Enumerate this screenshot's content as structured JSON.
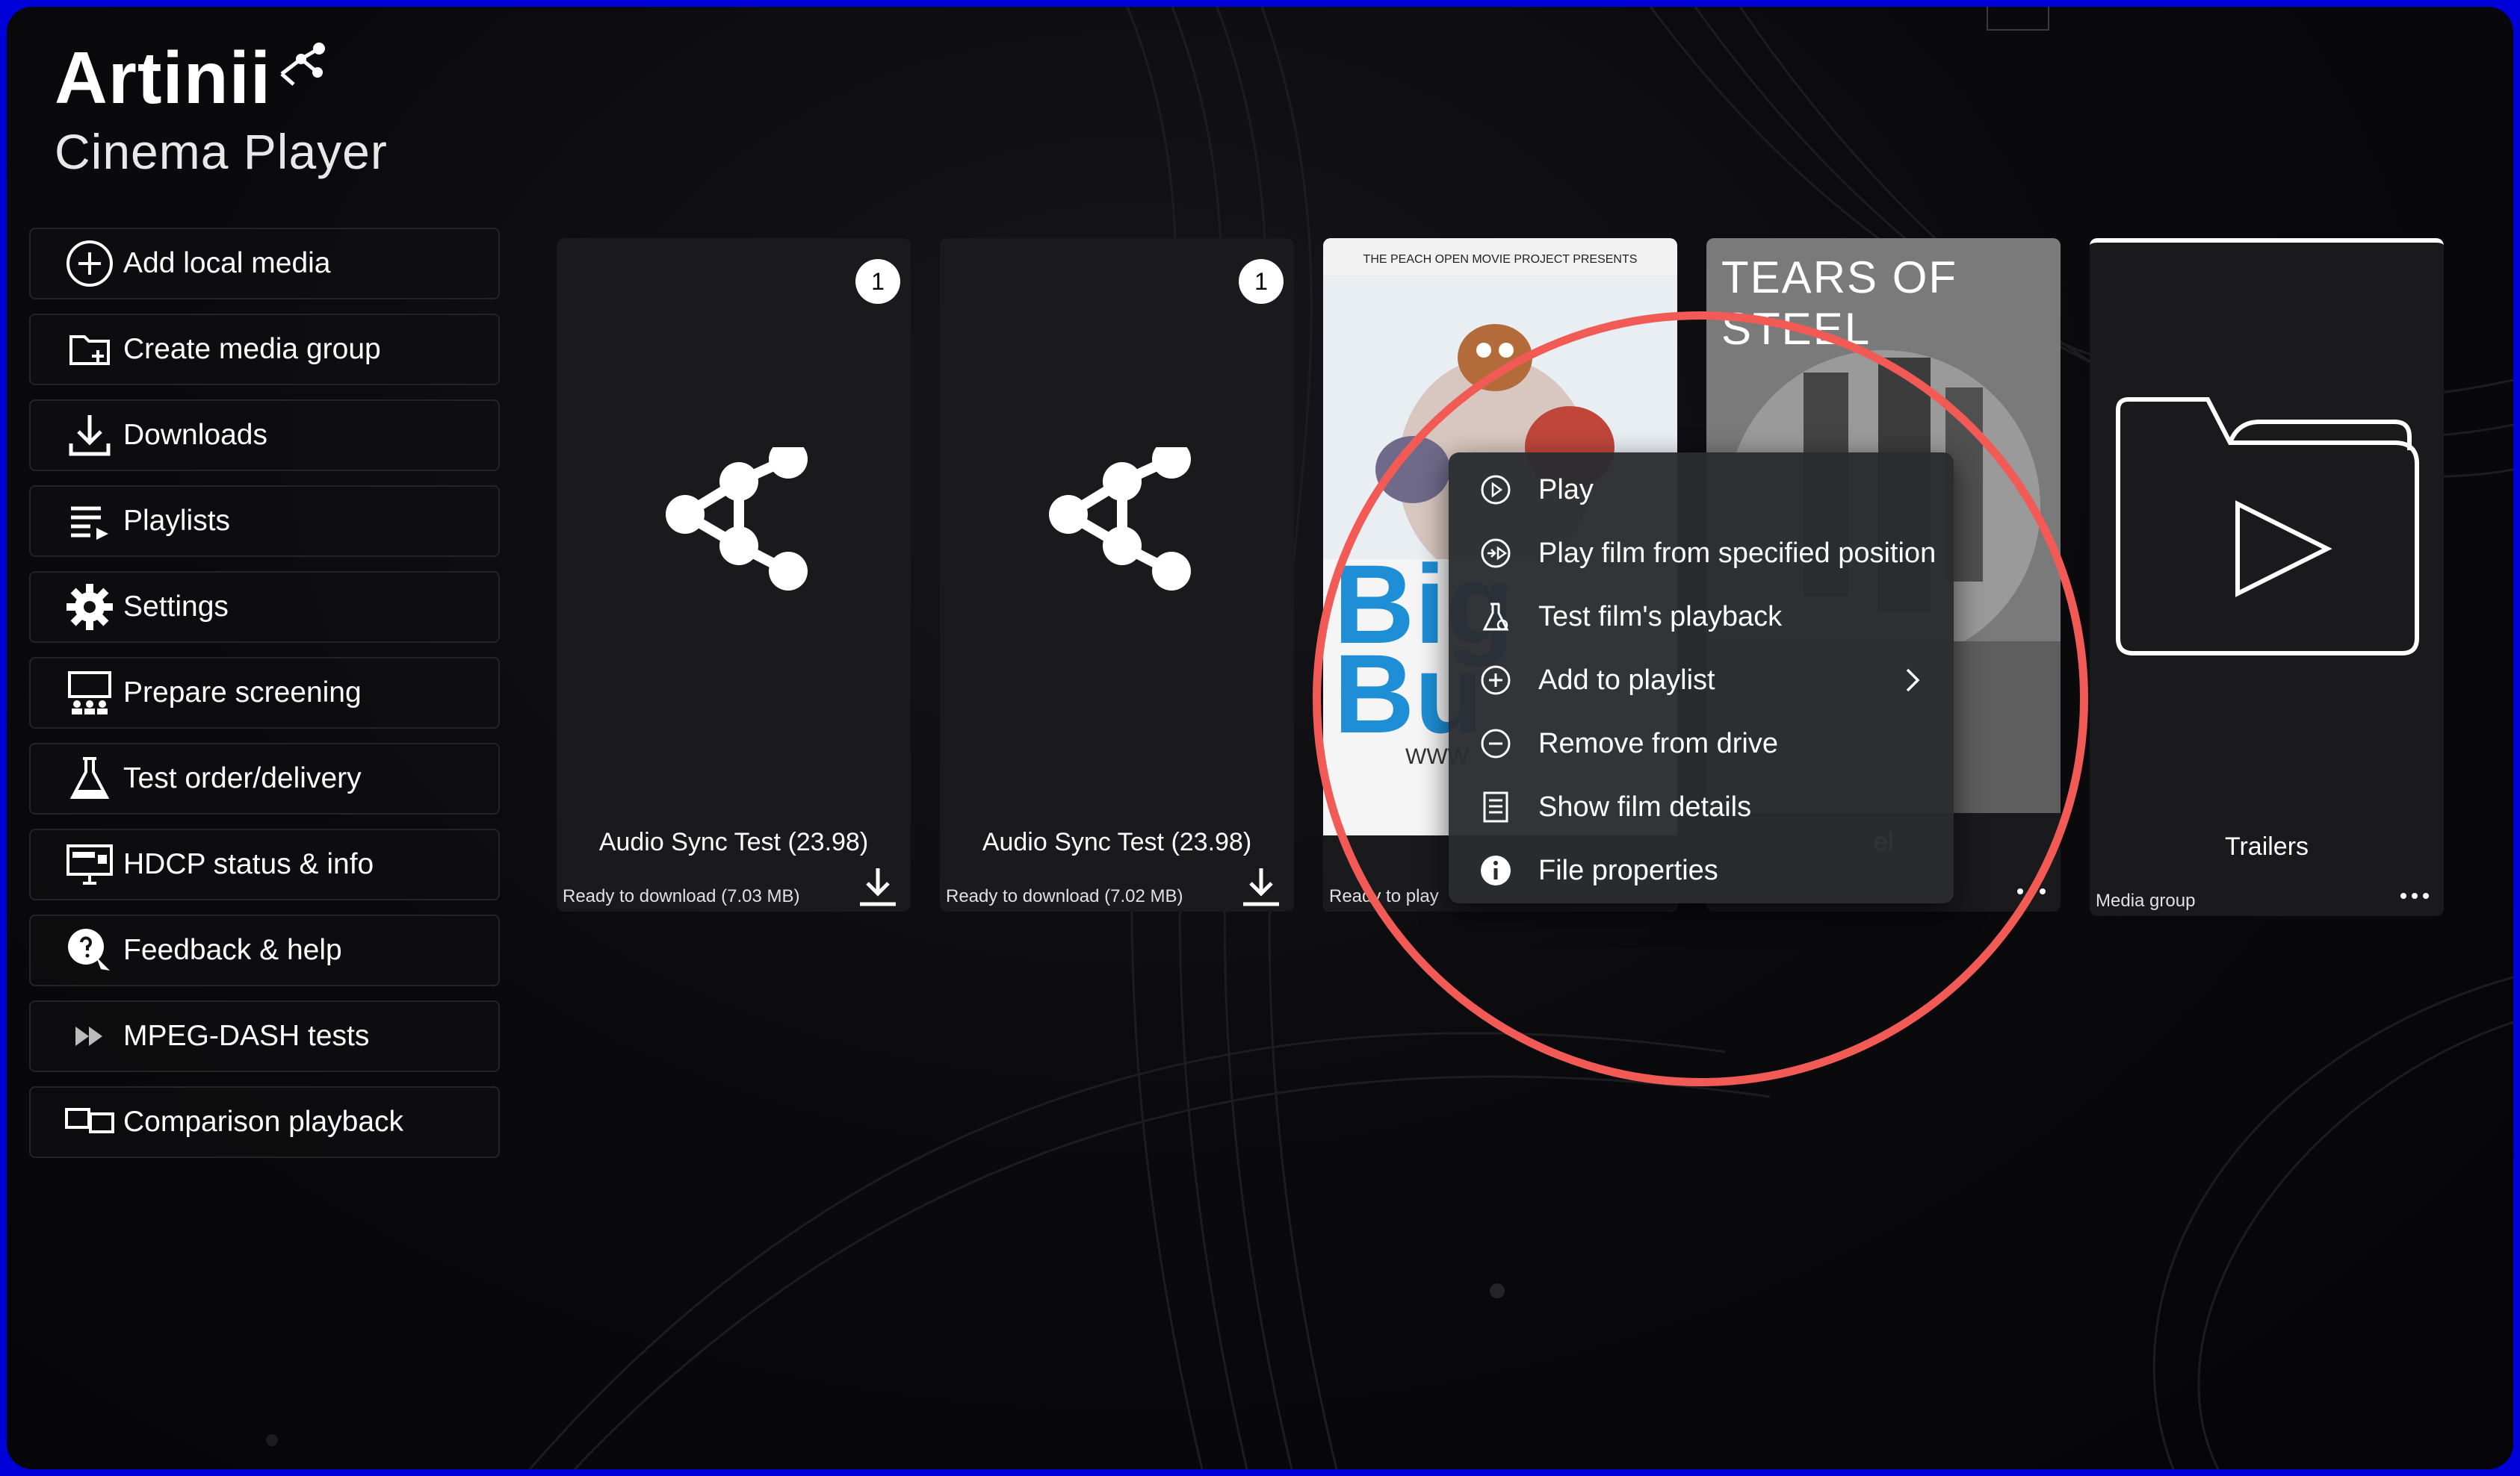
{
  "app": {
    "brand": "Artinii",
    "product": "Cinema Player"
  },
  "sidebar": {
    "items": [
      {
        "label": "Add local media",
        "icon": "add-circle-icon"
      },
      {
        "label": "Create media group",
        "icon": "folder-add-icon"
      },
      {
        "label": "Downloads",
        "icon": "download-icon"
      },
      {
        "label": "Playlists",
        "icon": "playlist-icon"
      },
      {
        "label": "Settings",
        "icon": "gear-icon"
      },
      {
        "label": "Prepare screening",
        "icon": "screening-icon"
      },
      {
        "label": "Test order/delivery",
        "icon": "flask-icon"
      },
      {
        "label": "HDCP status & info",
        "icon": "hdcp-monitor-icon"
      },
      {
        "label": "Feedback & help",
        "icon": "help-chat-icon"
      },
      {
        "label": "MPEG-DASH tests",
        "icon": "fast-forward-icon"
      },
      {
        "label": "Comparison playback",
        "icon": "dual-screen-icon"
      }
    ]
  },
  "cards": [
    {
      "title": "Audio Sync Test (23.98)",
      "status": "Ready to download (7.03 MB)",
      "badge": "1",
      "icon": "share-icon",
      "action": "download-icon"
    },
    {
      "title": "Audio Sync Test (23.98)",
      "status": "Ready to download (7.02 MB)",
      "badge": "1",
      "icon": "share-icon",
      "action": "download-icon"
    },
    {
      "title": "",
      "status": "Ready to play",
      "poster_header": "THE PEACH OPEN MOVIE PROJECT PRESENTS",
      "poster_title": "Big Bu",
      "poster_url_fragment": "WWW",
      "icon": "poster-image"
    },
    {
      "title": "el",
      "status": "",
      "poster_title": "TEARS OF STEEL",
      "icon": "poster-image",
      "action": "more-icon"
    },
    {
      "title": "Trailers",
      "status": "Media group",
      "icon": "folder-play-icon",
      "action": "more-icon"
    }
  ],
  "context_menu": {
    "items": [
      {
        "label": "Play",
        "icon": "play-circle-icon"
      },
      {
        "label": "Play film from specified position",
        "icon": "play-position-icon"
      },
      {
        "label": "Test film's playback",
        "icon": "flask-test-icon"
      },
      {
        "label": "Add to playlist",
        "icon": "add-circle-icon",
        "submenu": true
      },
      {
        "label": "Remove from drive",
        "icon": "remove-circle-icon"
      },
      {
        "label": "Show film details",
        "icon": "details-list-icon"
      },
      {
        "label": "File properties",
        "icon": "info-icon"
      }
    ]
  },
  "colors": {
    "frame": "#0000d8",
    "highlight": "#f25b55",
    "menu_bg": "#2a2c30",
    "card_bg": "#1a1a1d"
  }
}
